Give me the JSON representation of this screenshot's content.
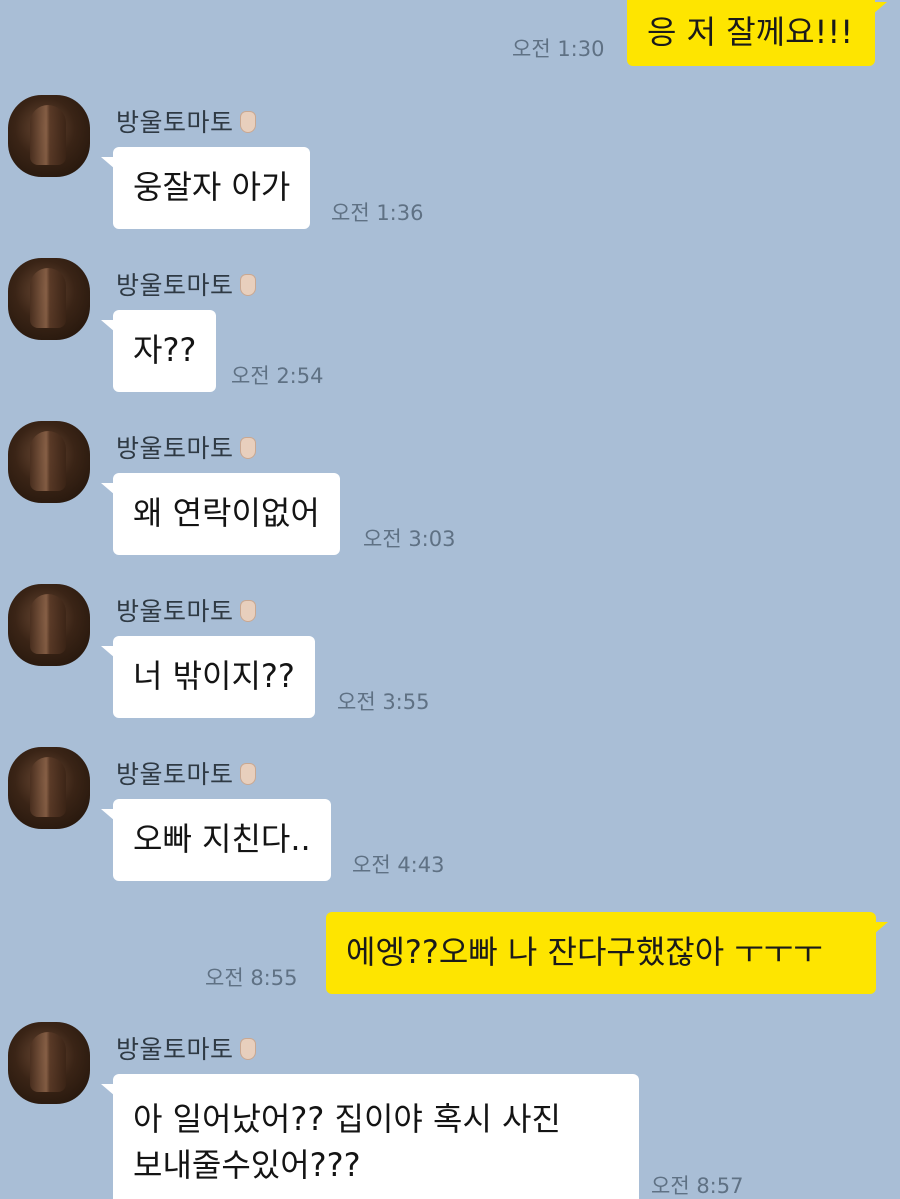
{
  "chat": {
    "messages": [
      {
        "direction": "out",
        "text": "응 저 잘께요!!!",
        "time": "오전 1:30"
      },
      {
        "direction": "in",
        "sender": "방울토마토",
        "text": "웅잘자 아가",
        "time": "오전 1:36"
      },
      {
        "direction": "in",
        "sender": "방울토마토",
        "text": "자??",
        "time": "오전 2:54"
      },
      {
        "direction": "in",
        "sender": "방울토마토",
        "text": "왜 연락이없어",
        "time": "오전 3:03"
      },
      {
        "direction": "in",
        "sender": "방울토마토",
        "text": "너 밖이지??",
        "time": "오전 3:55"
      },
      {
        "direction": "in",
        "sender": "방울토마토",
        "text": "오빠 지친다..",
        "time": "오전 4:43"
      },
      {
        "direction": "out",
        "text": "에엥??오빠 나 잔다구했잖아 ㅜㅜㅜ",
        "time": "오전 8:55"
      },
      {
        "direction": "in",
        "sender": "방울토마토",
        "text_lines": [
          "아 일어났어?? 집이야 혹시 사진",
          "보내줄수있어???"
        ],
        "time": "오전 8:57"
      }
    ]
  },
  "colors": {
    "background": "#a9bed6",
    "incoming_bubble": "#ffffff",
    "outgoing_bubble": "#fee500",
    "timestamp": "#5f7184"
  }
}
